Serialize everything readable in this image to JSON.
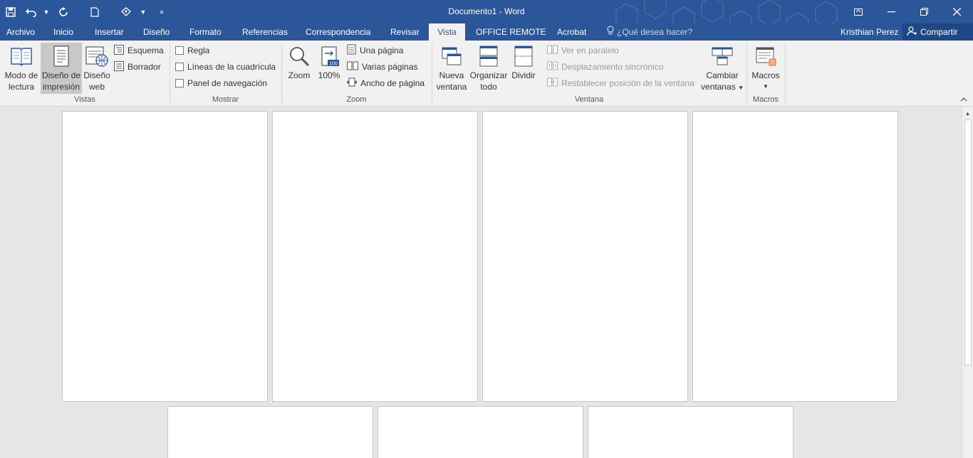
{
  "window": {
    "title": "Documento1 - Word",
    "qat": {
      "save_icon": "save-icon",
      "undo_icon": "undo-icon",
      "redo_icon": "repeat-icon",
      "new_icon": "new-document-icon",
      "touch_icon": "touch-mode-icon",
      "customize_icon": "customize-qat-icon"
    }
  },
  "tabs": [
    {
      "label": "Archivo"
    },
    {
      "label": "Inicio"
    },
    {
      "label": "Insertar"
    },
    {
      "label": "Diseño"
    },
    {
      "label": "Formato"
    },
    {
      "label": "Referencias"
    },
    {
      "label": "Correspondencia"
    },
    {
      "label": "Revisar"
    },
    {
      "label": "Vista",
      "active": true
    },
    {
      "label": "OFFICE REMOTE"
    },
    {
      "label": "Acrobat"
    }
  ],
  "tellme": {
    "placeholder": "¿Qué desea hacer?"
  },
  "user": {
    "name": "Kristhian Perez"
  },
  "share": {
    "label": "Compartir"
  },
  "ribbon": {
    "vistas": {
      "label": "Vistas",
      "modo_lectura": {
        "line1": "Modo de",
        "line2": "lectura"
      },
      "diseno_impresion": {
        "line1": "Diseño de",
        "line2": "impresión",
        "selected": true
      },
      "diseno_web": {
        "line1": "Diseño",
        "line2": "web"
      },
      "esquema": "Esquema",
      "borrador": "Borrador"
    },
    "mostrar": {
      "label": "Mostrar",
      "regla": "Regla",
      "lineas": "Líneas de la cuadrícula",
      "panel": "Panel de navegación"
    },
    "zoom": {
      "label": "Zoom",
      "zoom": "Zoom",
      "cien": "100%",
      "cien_badge": "100",
      "una_pagina": "Una página",
      "varias_paginas": "Varias páginas",
      "ancho_pagina": "Ancho de página"
    },
    "ventana": {
      "label": "Ventana",
      "nueva": {
        "line1": "Nueva",
        "line2": "ventana"
      },
      "organizar": {
        "line1": "Organizar",
        "line2": "todo"
      },
      "dividir": "Dividir",
      "paralelo": "Ver en paralelo",
      "desplazamiento": "Desplazamiento sincrónico",
      "restablecer": "Restablecer posición de la ventana",
      "cambiar": {
        "line1": "Cambiar",
        "line2": "ventanas"
      }
    },
    "macros": {
      "label": "Macros",
      "macros": "Macros"
    }
  },
  "colors": {
    "accent": "#2b579a",
    "ribbon": "#f1f1f1",
    "canvas": "#e6e6e6"
  }
}
